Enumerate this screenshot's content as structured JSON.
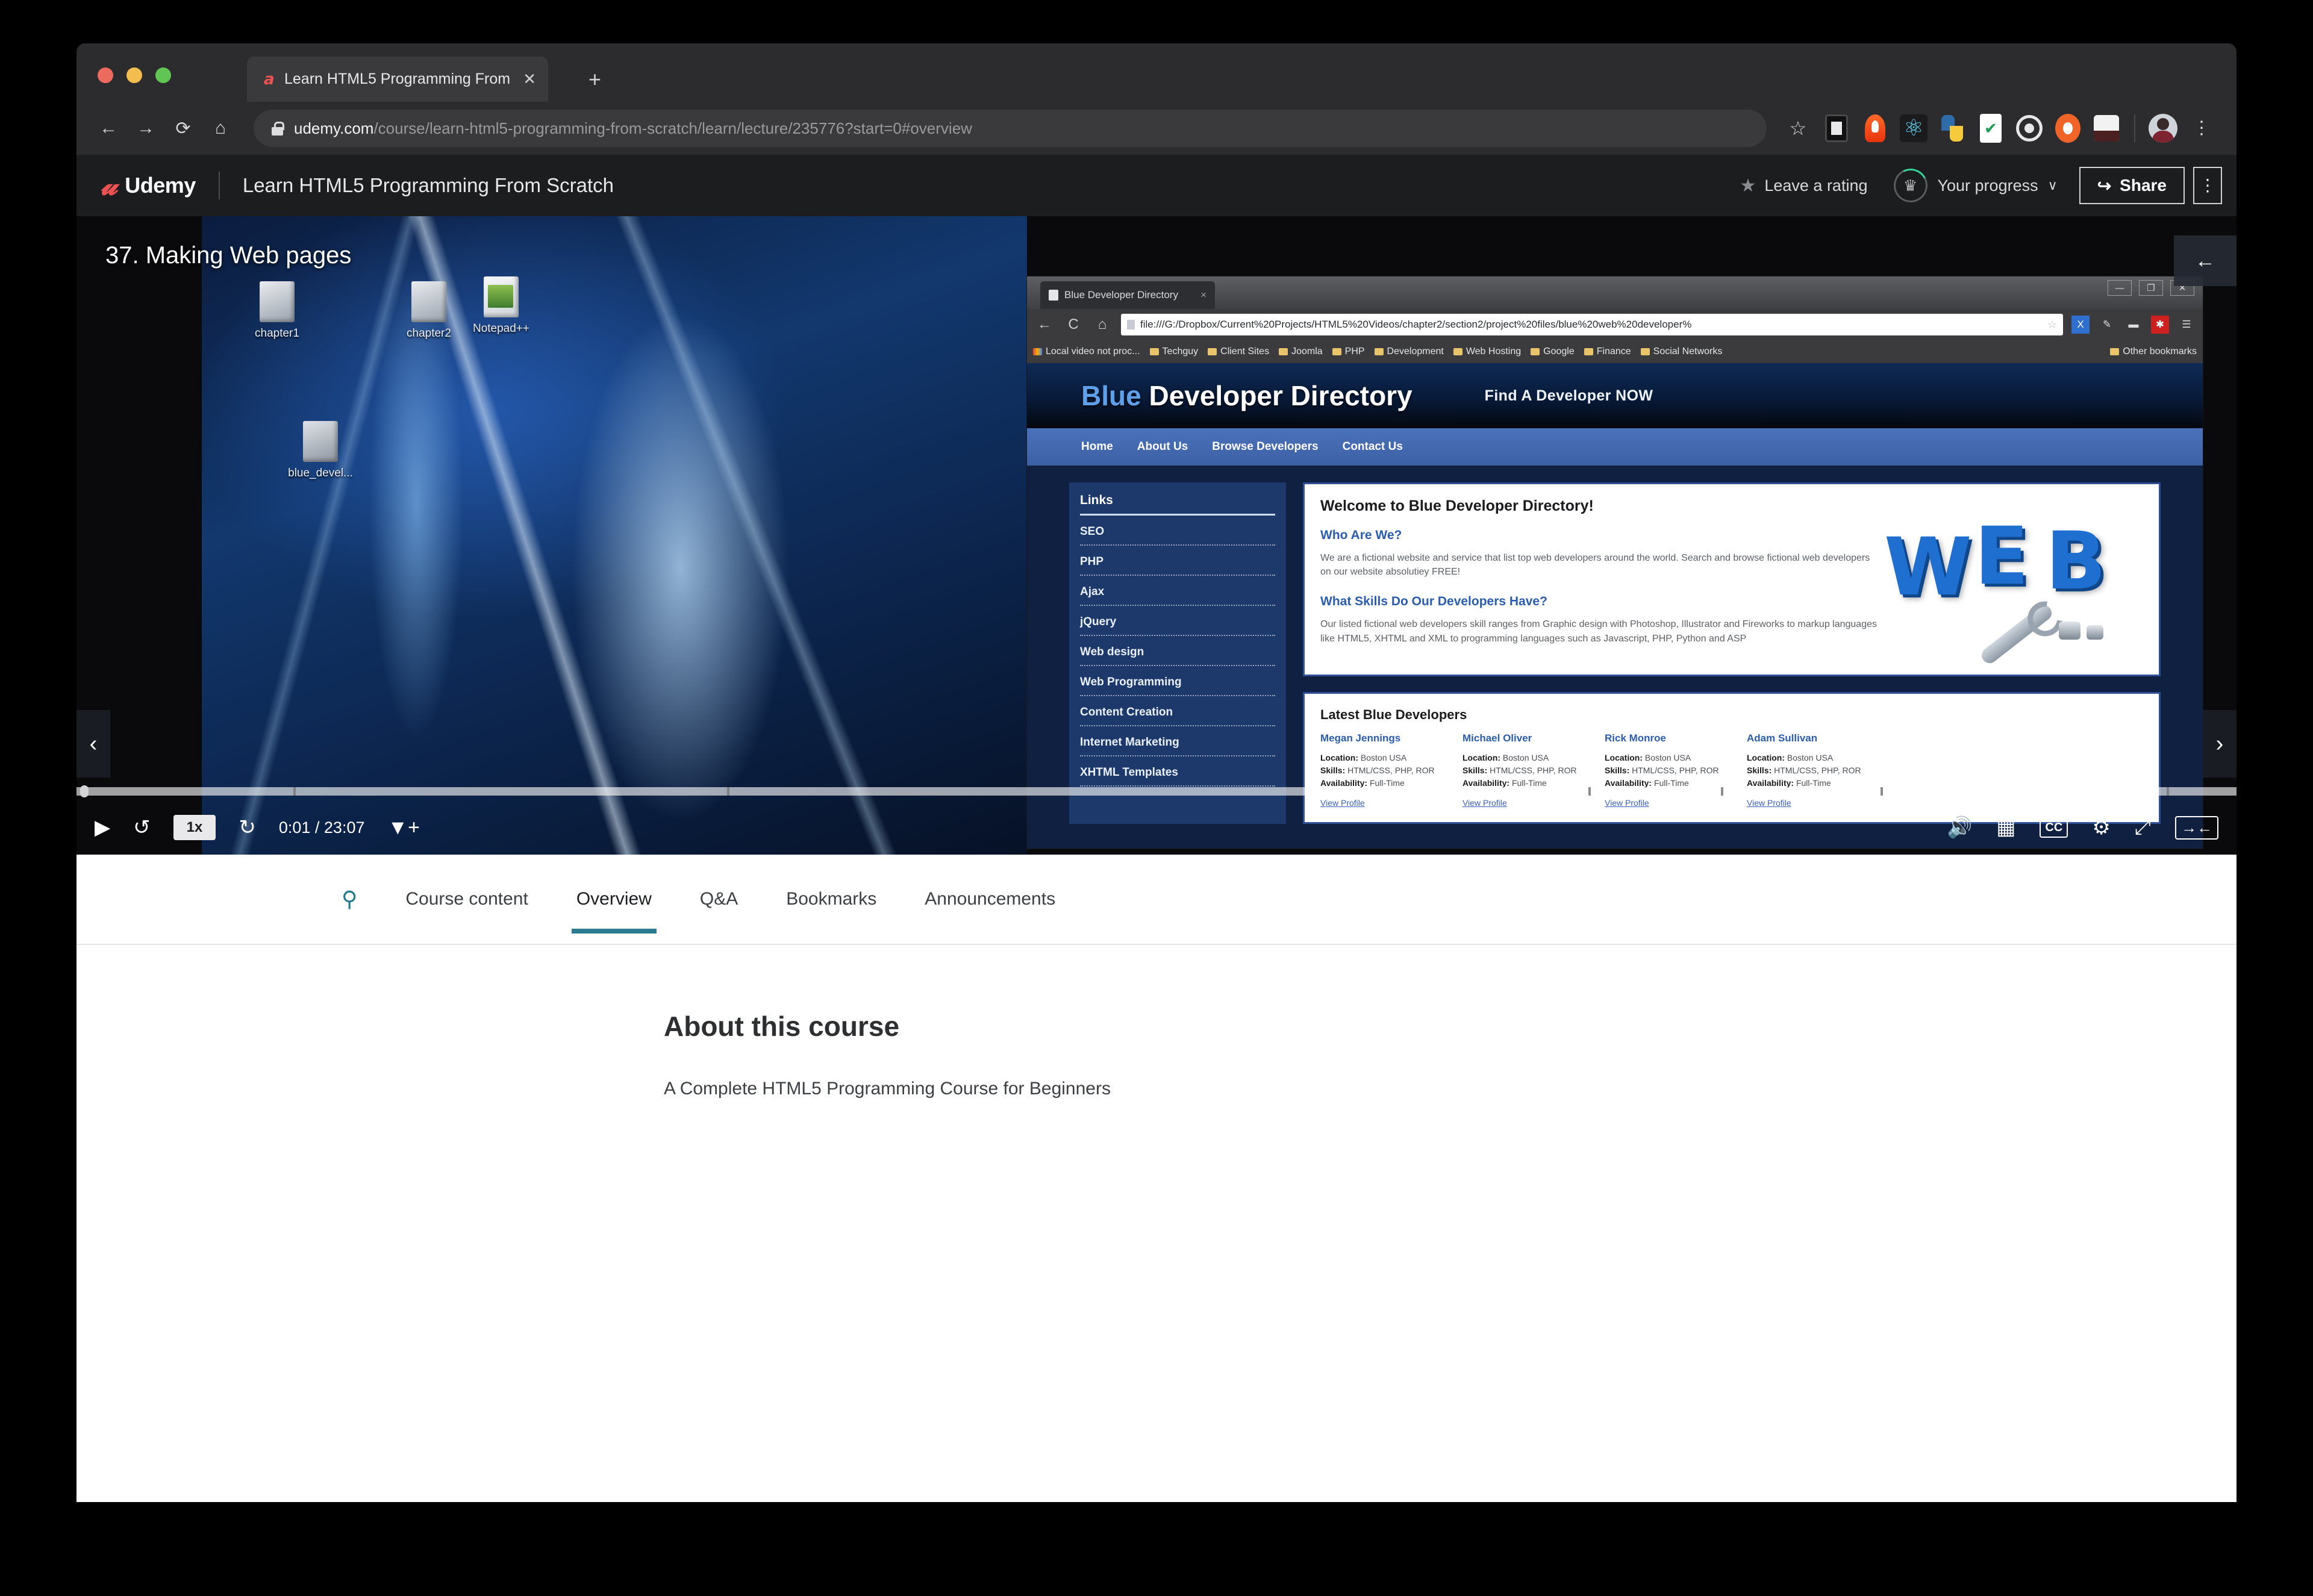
{
  "browser": {
    "tab": {
      "title": "Learn HTML5 Programming From",
      "close": "✕",
      "favicon": "udemy-favicon"
    },
    "new_tab": "+",
    "nav": {
      "back": "←",
      "forward": "→",
      "reload": "⟳",
      "home": "⌂"
    },
    "url_host": "udemy.com",
    "url_path": "/course/learn-html5-programming-from-scratch/learn/lecture/235776?start=0#overview",
    "bookmark_star": "☆",
    "kebab": "⋮"
  },
  "udemy_header": {
    "logo_mark": "𝓾",
    "logo_word": "Udemy",
    "course_title": "Learn HTML5 Programming From Scratch",
    "rating_label": "Leave a rating",
    "rating_star": "★",
    "progress_label": "Your progress",
    "progress_chevron": "∨",
    "trophy": "🏆",
    "share_label": "Share",
    "share_icon": "↪",
    "kebab": "⋮"
  },
  "player": {
    "lecture_title": "37. Making Web pages",
    "play_icon": "▶",
    "rewind_icon": "↺",
    "speed": "1x",
    "forward_icon": "↻",
    "time": "0:01 / 23:07",
    "bookmark_icon": "🔖",
    "volume_icon": "🔊",
    "transcript_icon": "▤",
    "cc_label": "CC",
    "settings_icon": "⚙",
    "fullscreen_icon": "⤢",
    "collapse_icon": "→←",
    "prev_arrow": "‹",
    "next_arrow": "›",
    "panel_toggle_arrow": "←",
    "desktop_icons": [
      {
        "label": "chapter1"
      },
      {
        "label": "chapter2"
      },
      {
        "label": "Notepad++"
      },
      {
        "label": "blue_devel..."
      }
    ]
  },
  "inner_browser": {
    "tab_title": "Blue Developer Directory",
    "tab_close": "×",
    "window_buttons": [
      "—",
      "❐",
      "✕"
    ],
    "nav": {
      "back": "←",
      "reload": "C",
      "home": "⌂"
    },
    "url": "file:///G:/Dropbox/Current%20Projects/HTML5%20Videos/chapter2/section2/project%20files/blue%20web%20developer%",
    "star": "☆",
    "bookmarks": [
      "Local video not proc...",
      "Techguy",
      "Client Sites",
      "Joomla",
      "PHP",
      "Development",
      "Web Hosting",
      "Google",
      "Finance",
      "Social Networks"
    ],
    "other_bookmarks": "Other bookmarks",
    "page": {
      "logo_blue": "Blue",
      "logo_rest": " Developer Directory",
      "tagline": "Find A Developer NOW",
      "nav_items": [
        "Home",
        "About Us",
        "Browse Developers",
        "Contact Us"
      ],
      "sidebar_heading": "Links",
      "sidebar_links": [
        "SEO",
        "PHP",
        "Ajax",
        "jQuery",
        "Web design",
        "Web Programming",
        "Content Creation",
        "Internet Marketing",
        "XHTML Templates"
      ],
      "welcome_title": "Welcome to Blue Developer Directory!",
      "who_heading": "Who Are We?",
      "who_text": "We are a fictional website and service that list top web developers around the world. Search and browse fictional web developers on our website absolutiey FREE!",
      "skills_heading": "What Skills Do Our Developers Have?",
      "skills_text": "Our listed fictional web developers skill ranges from Graphic design with Photoshop, Illustrator and Fireworks to markup languages like HTML5, XHTML and XML to programming languages such as Javascript, PHP, Python and ASP",
      "web_image_letters": [
        "W",
        "E",
        "B"
      ],
      "latest_heading": "Latest Blue Developers",
      "developers": [
        {
          "name": "Megan Jennings",
          "location_label": "Location:",
          "location": "Boston USA",
          "skills_label": "Skills:",
          "skills": "HTML/CSS, PHP, ROR",
          "availability_label": "Availability:",
          "availability": "Full-Time",
          "link": "View Profile"
        },
        {
          "name": "Michael Oliver",
          "location_label": "Location:",
          "location": "Boston USA",
          "skills_label": "Skills:",
          "skills": "HTML/CSS, PHP, ROR",
          "availability_label": "Availability:",
          "availability": "Full-Time",
          "link": "View Profile"
        },
        {
          "name": "Rick Monroe",
          "location_label": "Location:",
          "location": "Boston USA",
          "skills_label": "Skills:",
          "skills": "HTML/CSS, PHP, ROR",
          "availability_label": "Availability:",
          "availability": "Full-Time",
          "link": "View Profile"
        },
        {
          "name": "Adam Sullivan",
          "location_label": "Location:",
          "location": "Boston USA",
          "skills_label": "Skills:",
          "skills": "HTML/CSS, PHP, ROR",
          "availability_label": "Availability:",
          "availability": "Full-Time",
          "link": "View Profile"
        }
      ]
    }
  },
  "tabs": {
    "search_icon": "search-icon",
    "items": [
      {
        "label": "Course content",
        "active": false
      },
      {
        "label": "Overview",
        "active": true
      },
      {
        "label": "Q&A",
        "active": false
      },
      {
        "label": "Bookmarks",
        "active": false
      },
      {
        "label": "Announcements",
        "active": false
      }
    ]
  },
  "about": {
    "title": "About this course",
    "subtitle": "A Complete HTML5 Programming Course for Beginners"
  },
  "colors": {
    "udemy_red": "#ec5252",
    "header_dark": "#1c1d1f",
    "tab_accent": "#2d7a93",
    "bdd_blue": "#2a5db0"
  }
}
